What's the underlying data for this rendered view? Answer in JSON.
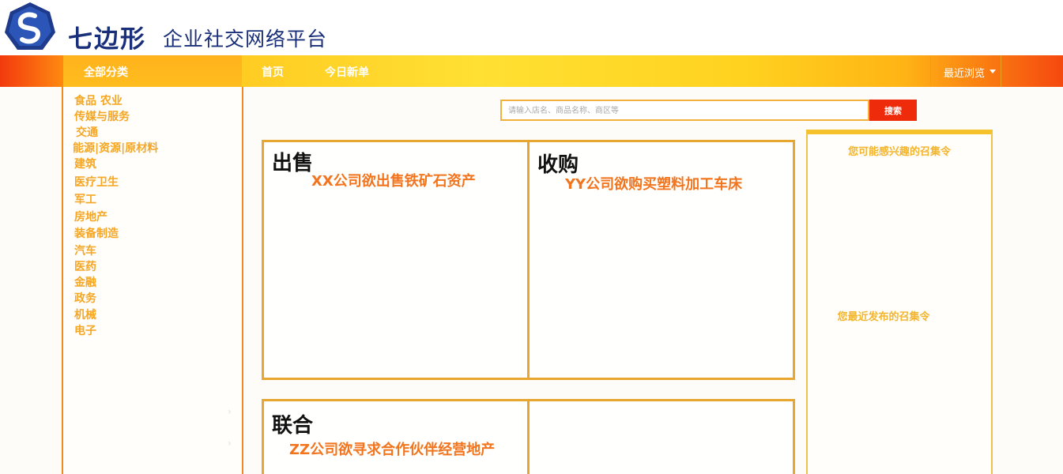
{
  "brand": {
    "logo_icon": "heptagon-s-logo",
    "name": "七边形",
    "tagline": "企业社交网络平台",
    "colors": {
      "navy": "#1a2f7a",
      "orange": "#f5a623",
      "red": "#ee2b0b"
    }
  },
  "nav": {
    "all_categories": "全部分类",
    "home": "首页",
    "today_new": "今日新单",
    "recent": "最近浏览"
  },
  "sidebar": {
    "items": [
      "食品 农业",
      "传媒与服务",
      "交通",
      "能源|资源|原材料",
      "建筑",
      "医疗卫生",
      "军工",
      "房地产",
      "装备制造",
      "汽车",
      "医药",
      "金融",
      "政务",
      "机械",
      "电子"
    ]
  },
  "search": {
    "placeholder": "请输入店名、商品名称、商区等",
    "button": "搜索"
  },
  "panels": {
    "sell": {
      "title": "出售",
      "item": "XX公司欲出售铁矿石资产"
    },
    "buy": {
      "title": "收购",
      "item": "YY公司欲购买塑料加工车床"
    },
    "joint": {
      "title": "联合",
      "item": "ZZ公司欲寻求合作伙伴经营地产"
    }
  },
  "right": {
    "interest": "您可能感兴趣的召集令",
    "recent_posted": "您最近发布的召集令"
  }
}
